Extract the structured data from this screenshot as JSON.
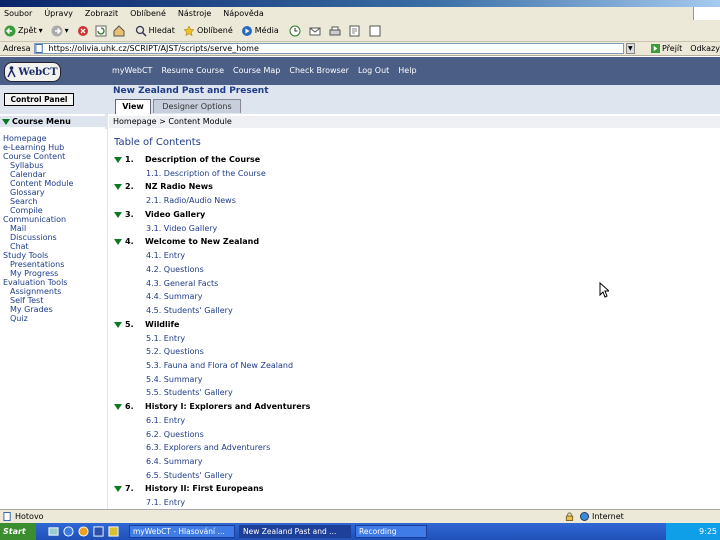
{
  "menubar": [
    "Soubor",
    "Úpravy",
    "Zobrazit",
    "Oblíbené",
    "Nástroje",
    "Nápověda"
  ],
  "toolbar": {
    "back": "Zpět",
    "search": "Hledat",
    "favorites": "Oblíbené",
    "media": "Média"
  },
  "address": {
    "label": "Adresa",
    "url": "https://olivia.uhk.cz/SCRIPT/AJST/scripts/serve_home",
    "go": "Přejít",
    "links": "Odkazy"
  },
  "webct": {
    "logo": "WebCT",
    "nav": [
      "myWebCT",
      "Resume Course",
      "Course Map",
      "Check Browser",
      "Log Out",
      "Help"
    ],
    "course_title": "New Zealand Past and Present",
    "control_panel": "Control Panel",
    "tabs": {
      "view": "View",
      "designer": "Designer Options"
    },
    "course_menu": "Course Menu",
    "breadcrumb": "Homepage > Content Module",
    "toc_title": "Table of Contents",
    "sidebar": [
      "Homepage",
      "e-Learning Hub",
      "Course Content",
      "Syllabus",
      "Calendar",
      "Content Module",
      "Glossary",
      "Search",
      "Compile",
      "Communication",
      "Mail",
      "Discussions",
      "Chat",
      "Study Tools",
      "Presentations",
      "My Progress",
      "Evaluation Tools",
      "Assignments",
      "Self Test",
      "My Grades",
      "Quiz"
    ],
    "modules": [
      {
        "num": "1.",
        "title": "Description of the Course",
        "items": [
          "1.1. Description of the Course"
        ]
      },
      {
        "num": "2.",
        "title": "NZ Radio News",
        "items": [
          "2.1. Radio/Audio News"
        ]
      },
      {
        "num": "3.",
        "title": "Video Gallery",
        "items": [
          "3.1. Video Gallery"
        ]
      },
      {
        "num": "4.",
        "title": "Welcome to New Zealand",
        "items": [
          "4.1. Entry",
          "4.2. Questions",
          "4.3. General Facts",
          "4.4. Summary",
          "4.5. Students' Gallery"
        ]
      },
      {
        "num": "5.",
        "title": "Wildlife",
        "items": [
          "5.1. Entry",
          "5.2. Questions",
          "5.3. Fauna and Flora of New Zealand",
          "5.4. Summary",
          "5.5. Students' Gallery"
        ]
      },
      {
        "num": "6.",
        "title": "History I: Explorers and Adventurers",
        "items": [
          "6.1. Entry",
          "6.2. Questions",
          "6.3. Explorers and Adventurers",
          "6.4. Summary",
          "6.5. Students' Gallery"
        ]
      },
      {
        "num": "7.",
        "title": "History II: First Europeans",
        "items": [
          "7.1. Entry"
        ]
      }
    ]
  },
  "status": {
    "text": "Hotovo",
    "zone": "Internet"
  },
  "taskbar": {
    "start": "Start",
    "tasks": [
      "myWebCT - Hlasování ...",
      "New Zealand Past and ...",
      "Recording"
    ],
    "clock": "9:25"
  }
}
